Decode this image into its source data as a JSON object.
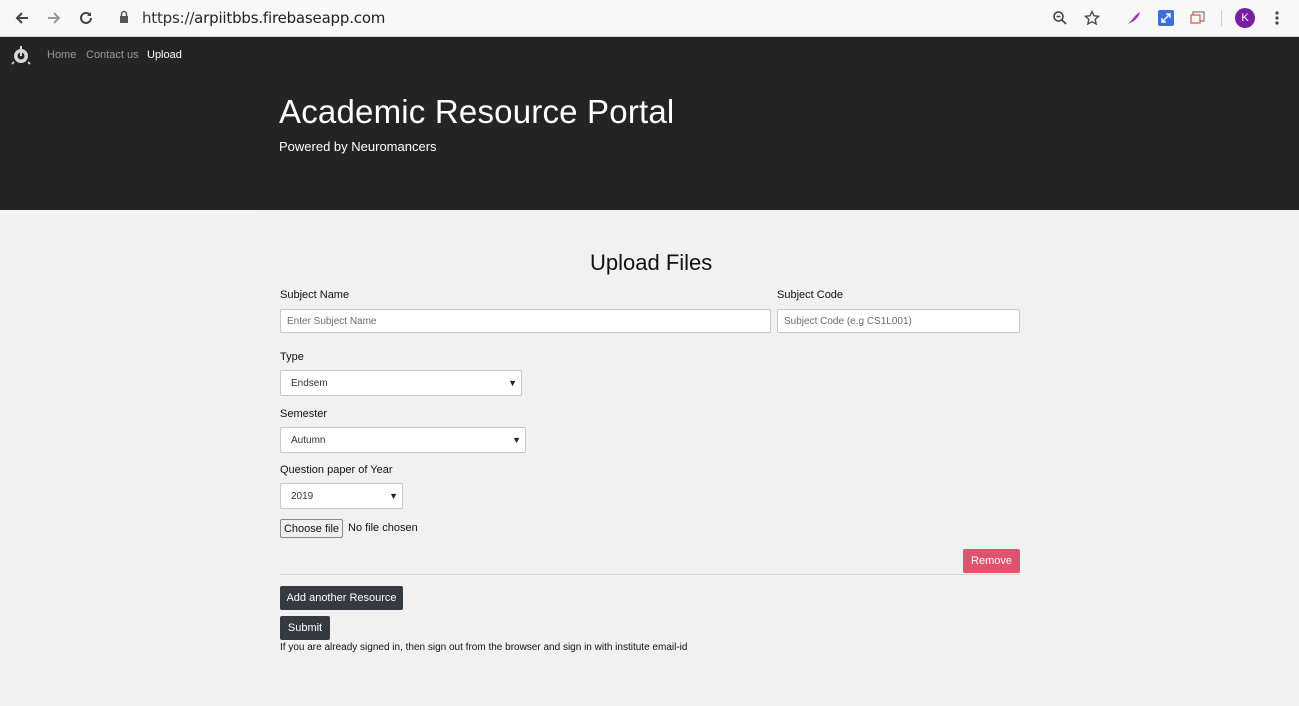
{
  "browser": {
    "url_scheme": "https://",
    "url_host": "arpiitbbs.firebaseapp.com",
    "profile_initial": "K"
  },
  "nav": {
    "links": [
      {
        "label": "Home",
        "active": false
      },
      {
        "label": "Contact us",
        "active": false
      },
      {
        "label": "Upload",
        "active": true
      }
    ]
  },
  "hero": {
    "title": "Academic Resource Portal",
    "subtitle": "Powered by Neuromancers"
  },
  "form": {
    "heading": "Upload Files",
    "subject_name": {
      "label": "Subject Name",
      "placeholder": "Enter Subject Name",
      "value": ""
    },
    "subject_code": {
      "label": "Subject Code",
      "placeholder": "Subject Code (e.g CS1L001)",
      "value": ""
    },
    "type": {
      "label": "Type",
      "selected": "Endsem"
    },
    "semester": {
      "label": "Semester",
      "selected": "Autumn"
    },
    "year": {
      "label": "Question paper of Year",
      "selected": "2019"
    },
    "file": {
      "button_label": "Choose file",
      "status": "No file chosen"
    },
    "remove_label": "Remove",
    "add_resource_label": "Add another Resource",
    "submit_label": "Submit",
    "note": "If you are already signed in, then sign out from the browser and sign in with institute email-id"
  },
  "colors": {
    "hero_bg": "#242424",
    "remove_button": "#e0536f",
    "dark_button": "#343a40",
    "profile_avatar": "#7b1fa2"
  }
}
